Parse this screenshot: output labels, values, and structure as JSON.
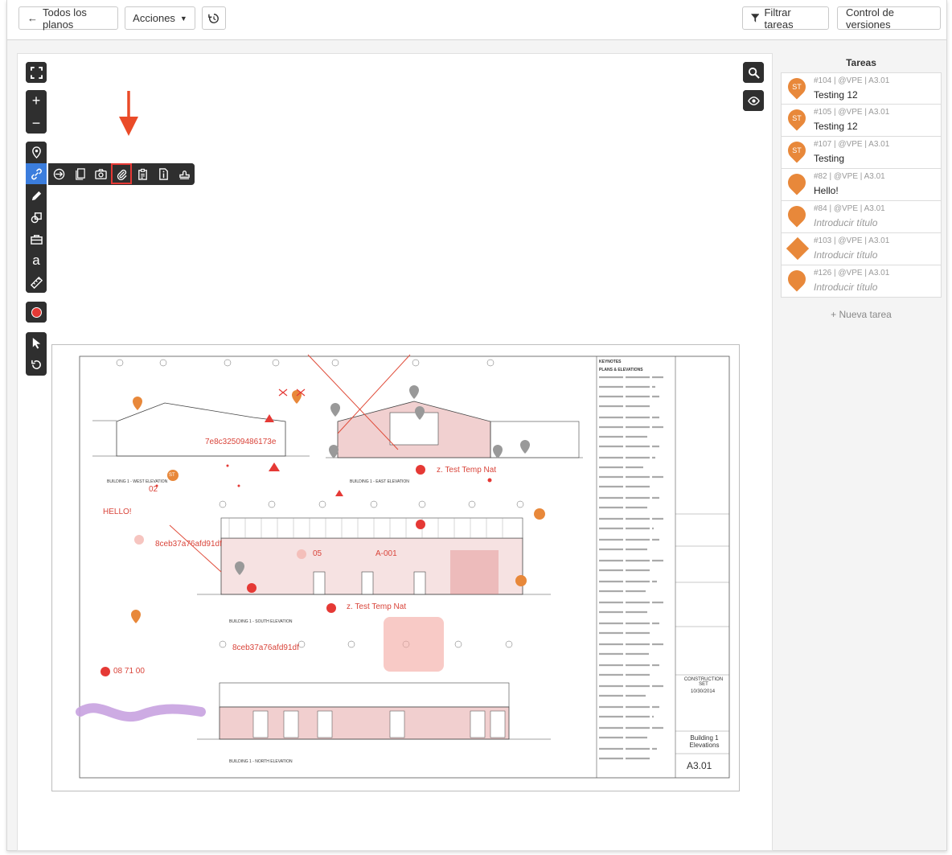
{
  "toolbar": {
    "all_plans": "Todos los planos",
    "actions": "Acciones",
    "filter_tasks": "Filtrar tareas",
    "version_control": "Control de versiones"
  },
  "tasks_panel": {
    "title": "Tareas",
    "tasks": [
      {
        "meta": "#104 | @VPE | A3.01",
        "title": "Testing 12",
        "badge": "ST",
        "shape": "pin",
        "placeholder": false
      },
      {
        "meta": "#105 | @VPE | A3.01",
        "title": "Testing 12",
        "badge": "ST",
        "shape": "pin",
        "placeholder": false
      },
      {
        "meta": "#107 | @VPE | A3.01",
        "title": "Testing",
        "badge": "ST",
        "shape": "pin",
        "placeholder": false
      },
      {
        "meta": "#82 | @VPE | A3.01",
        "title": "Hello!",
        "badge": "",
        "shape": "pin",
        "placeholder": false
      },
      {
        "meta": "#84 | @VPE | A3.01",
        "title": "Introducir título",
        "badge": "",
        "shape": "pin",
        "placeholder": true
      },
      {
        "meta": "#103 | @VPE | A3.01",
        "title": "Introducir título",
        "badge": "",
        "shape": "diamond",
        "placeholder": true
      },
      {
        "meta": "#126 | @VPE | A3.01",
        "title": "Introducir título",
        "badge": "",
        "shape": "pin",
        "placeholder": true
      }
    ],
    "new_task": "+ Nueva tarea"
  },
  "drawing": {
    "annotations": {
      "file1": "7e8c32509486173e",
      "file2": "8ceb37a76afd91df",
      "file3": "8ceb37a76afd91df",
      "text_hello": "HELLO!",
      "label_02": "02",
      "label_05": "05",
      "label_a001": "A-001",
      "temp1": "z. Test Temp Nat",
      "temp2": "z. Test Temp Nat",
      "code": "08 71 00",
      "st": "ST"
    },
    "west_title": "BUILDING 1 - WEST ELEVATION",
    "east_title": "BUILDING 1 - EAST ELEVATION",
    "south_title": "BUILDING 1 - SOUTH ELEVATION",
    "north_title": "BUILDING 1 - NORTH ELEVATION",
    "keynotes": "KEYNOTES",
    "plans_elev": "PLANS & ELEVATIONS",
    "set_name": "CONSTRUCTION SET",
    "set_date": "10/30/2014",
    "sheet_title": "Building 1 Elevations",
    "sheet_number": "A3.01"
  },
  "colors": {
    "accent": "#e8883a",
    "markup": "#d9443a",
    "highlight": "#c8a2e0",
    "toolbar": "#2f2f2f",
    "active_tool": "#3b7ddd"
  }
}
